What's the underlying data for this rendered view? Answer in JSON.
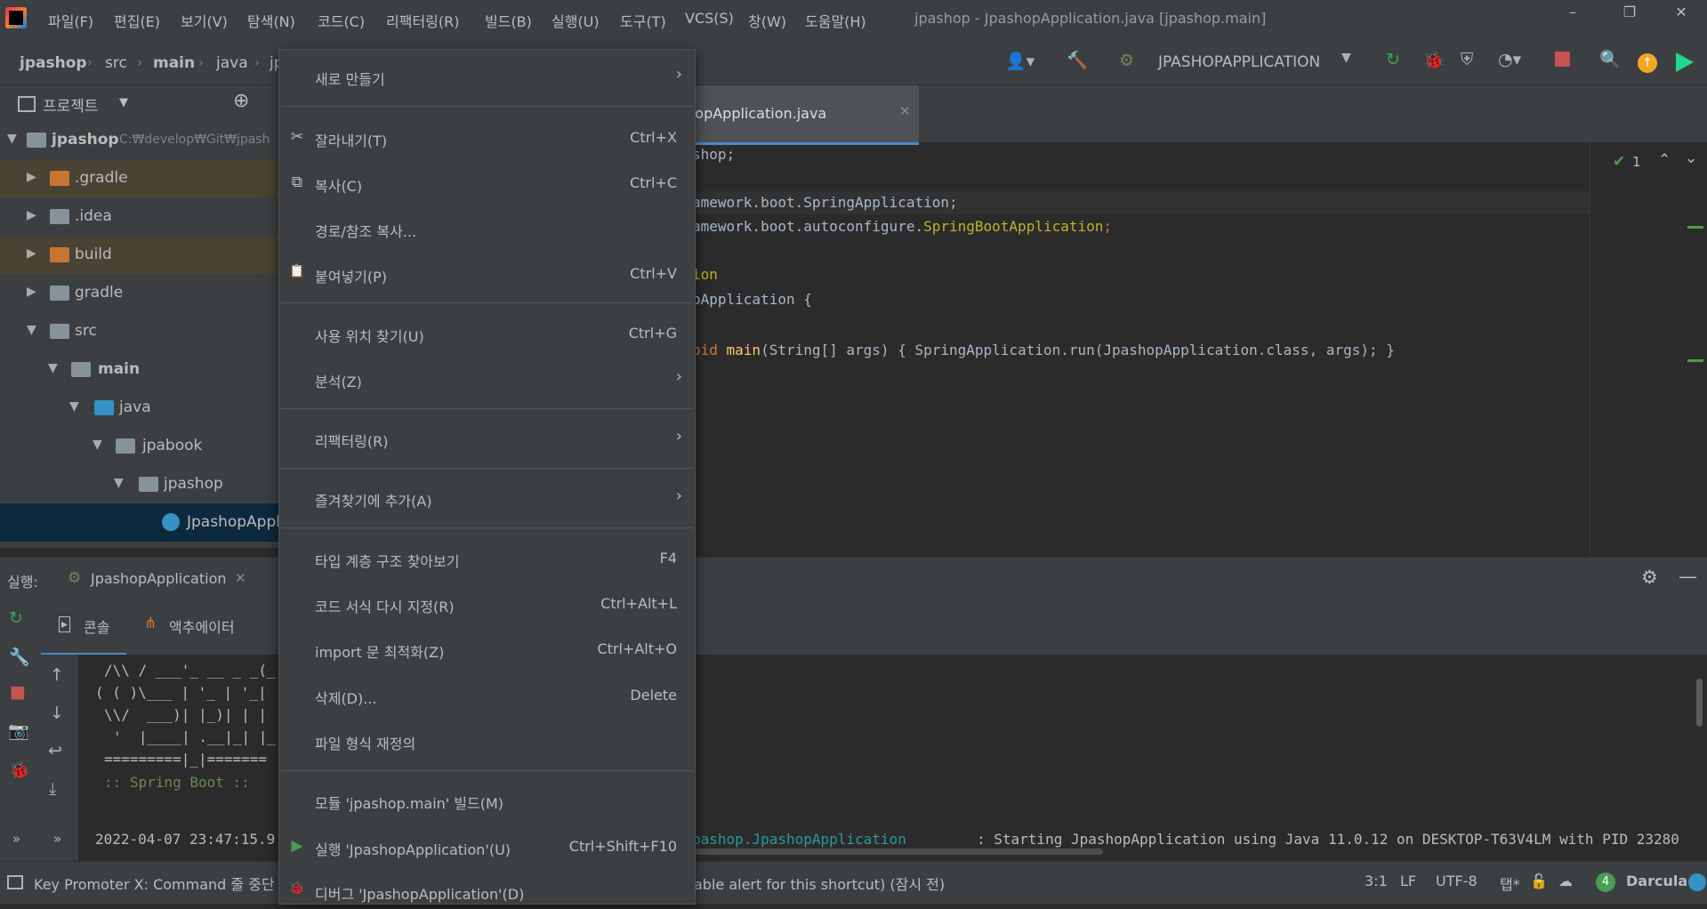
{
  "menubar": {
    "items": [
      "파일(F)",
      "편집(E)",
      "보기(V)",
      "탐색(N)",
      "코드(C)",
      "리팩터링(R)",
      "빌드(B)",
      "실행(U)",
      "도구(T)",
      "VCS(S)",
      "창(W)",
      "도움말(H)"
    ],
    "title": "jpashop - JpashopApplication.java [jpashop.main]"
  },
  "navbar": {
    "breadcrumbs": [
      "jpashop",
      "src",
      "main",
      "java",
      "jp"
    ],
    "run_config": "JPASHOPAPPLICATION"
  },
  "project": {
    "header": "프로젝트",
    "root_label": "jpashop",
    "root_path": "C:₩develop₩Git₩jpash",
    "items": [
      ".gradle",
      ".idea",
      "build",
      "gradle",
      "src",
      "main",
      "java",
      "jpabook",
      "jpashop",
      "JpashopApplic"
    ]
  },
  "editor": {
    "tab_label": "ashopApplication.java",
    "inspection_count": "1",
    "lines": [
      {
        "a": "shop;",
        "b": "",
        "c": ""
      },
      {
        "a": "amework.boot.SpringApplication;",
        "b": "",
        "c": ""
      },
      {
        "a": "amework.boot.autoconfigure.",
        "b": "SpringBootApplication",
        "c": ";"
      },
      {
        "a": "ion",
        "b": "",
        "c": ""
      },
      {
        "a": "pApplication {",
        "b": "",
        "c": ""
      },
      {
        "a": "oid ",
        "b": "main",
        "c": "(String[] args) { SpringApplication.run(JpashopApplication.class, args); }"
      }
    ]
  },
  "run": {
    "label": "실행:",
    "tab": "JpashopApplication",
    "subtabs": [
      "콘솔",
      "액추에이터"
    ],
    "banner": [
      "/\\\\ / ___'_ __ _ _(_",
      "( ( )\\___ | '_ | '_|",
      "\\\\/  ___)| |_)| | |",
      "'  |____| .__|_| |_",
      "=========|_|=======",
      ":: Spring Boot ::"
    ],
    "log_time": "2022-04-07 23:47:15.9",
    "log_class": "pashop.JpashopApplication",
    "log_msg": ": Starting JpashopApplication using Java 11.0.12 on DESKTOP-T63V4LM with PID 23280"
  },
  "status": {
    "message": "Key Promoter X: Command 줄 중단",
    "message_tail": "able alert for this shortcut) (잠시 전)",
    "position": "3:1",
    "line_sep": "LF",
    "encoding": "UTF-8",
    "indent": "탭*",
    "badge": "4",
    "theme": "Darcula"
  },
  "context_menu": {
    "items": [
      {
        "label": "새로 만들기",
        "shortcut": "",
        "submenu": true
      },
      {
        "label": "잘라내기(T)",
        "shortcut": "Ctrl+X",
        "icon": "✂"
      },
      {
        "label": "복사(C)",
        "shortcut": "Ctrl+C",
        "icon": "⧉"
      },
      {
        "label": "경로/참조 복사...",
        "shortcut": ""
      },
      {
        "label": "붙여넣기(P)",
        "shortcut": "Ctrl+V",
        "icon": "📋"
      },
      {
        "label": "사용 위치 찾기(U)",
        "shortcut": "Ctrl+G"
      },
      {
        "label": "분석(Z)",
        "shortcut": "",
        "submenu": true
      },
      {
        "label": "리팩터링(R)",
        "shortcut": "",
        "submenu": true
      },
      {
        "label": "즐겨찾기에 추가(A)",
        "shortcut": "",
        "submenu": true
      },
      {
        "label": "타입 계층 구조 찾아보기",
        "shortcut": "F4"
      },
      {
        "label": "코드 서식 다시 지정(R)",
        "shortcut": "Ctrl+Alt+L"
      },
      {
        "label": "import 문 최적화(Z)",
        "shortcut": "Ctrl+Alt+O"
      },
      {
        "label": "삭제(D)...",
        "shortcut": "Delete"
      },
      {
        "label": "파일 형식 재정의",
        "shortcut": ""
      },
      {
        "label": "모듈 'jpashop.main' 빌드(M)",
        "shortcut": ""
      },
      {
        "label": "실행 'JpashopApplication'(U)",
        "shortcut": "Ctrl+Shift+F10",
        "icon": "▶"
      },
      {
        "label": "디버그 'JpashopApplication'(D)",
        "shortcut": "",
        "icon": "🐞"
      }
    ]
  },
  "colors": {
    "accent": "#4a88c7",
    "selection": "#0d293e",
    "excluded": "#4a4334",
    "keyword": "#cc7832",
    "annotation": "#bbb529",
    "function": "#ffc66d",
    "run_green": "#499c54",
    "stop_red": "#c75450"
  }
}
